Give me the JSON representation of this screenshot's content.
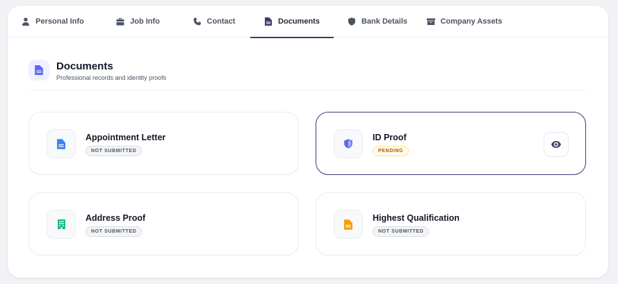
{
  "tabs": [
    {
      "label": "Personal Info",
      "icon": "user-icon"
    },
    {
      "label": "Job Info",
      "icon": "briefcase-icon"
    },
    {
      "label": "Contact",
      "icon": "phone-icon"
    },
    {
      "label": "Documents",
      "icon": "file-icon",
      "active": true
    },
    {
      "label": "Bank Details",
      "icon": "shield-icon"
    },
    {
      "label": "Company Assets",
      "icon": "box-icon"
    }
  ],
  "section": {
    "title": "Documents",
    "subtitle": "Professional records and identity proofs",
    "icon": "file-text-icon"
  },
  "documents": [
    {
      "name": "Appointment Letter",
      "status": "NOT SUBMITTED",
      "icon": "file-icon",
      "icon_color": "#3b82f6"
    },
    {
      "name": "ID Proof",
      "status": "PENDING",
      "icon": "shield-icon",
      "icon_color": "#6366f1",
      "selected": true,
      "view_label": "View"
    },
    {
      "name": "Address Proof",
      "status": "NOT SUBMITTED",
      "icon": "building-icon",
      "icon_color": "#10b981"
    },
    {
      "name": "Highest Qualification",
      "status": "NOT SUBMITTED",
      "icon": "file-icon",
      "icon_color": "#f59e0b"
    }
  ],
  "colors": {
    "accent": "#3b3a66",
    "pending_text": "#b45309",
    "pending_bg": "#fffbeb"
  }
}
